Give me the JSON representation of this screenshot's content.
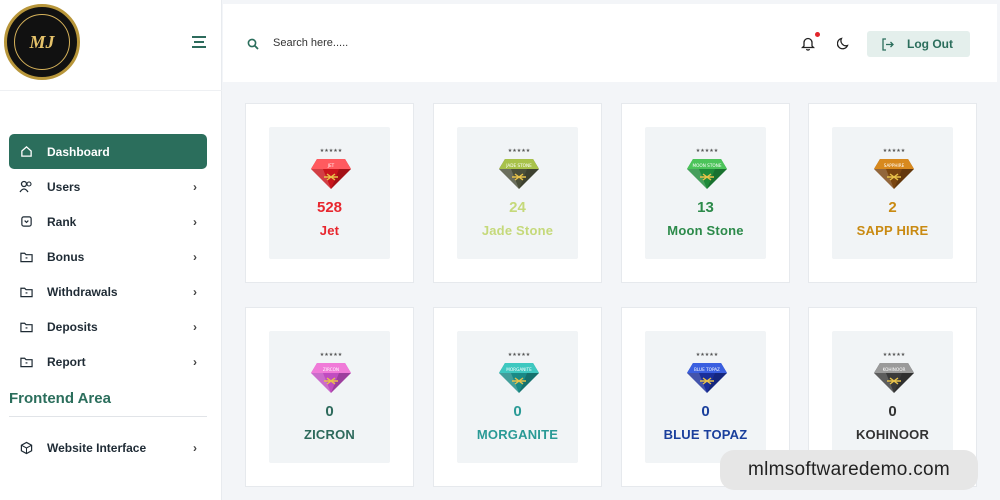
{
  "brand": {
    "logo_text": "MJ"
  },
  "search": {
    "placeholder": "Search here....."
  },
  "topbar": {
    "logout_label": "Log Out"
  },
  "sidebar": {
    "items": [
      {
        "label": "Dashboard",
        "icon": "home-icon",
        "active": true
      },
      {
        "label": "Users",
        "icon": "users-icon"
      },
      {
        "label": "Rank",
        "icon": "rank-icon"
      },
      {
        "label": "Bonus",
        "icon": "folder-icon"
      },
      {
        "label": "Withdrawals",
        "icon": "folder-icon"
      },
      {
        "label": "Deposits",
        "icon": "folder-icon"
      },
      {
        "label": "Report",
        "icon": "folder-icon"
      }
    ],
    "frontend_title": "Frontend Area",
    "frontend_items": [
      {
        "label": "Website Interface",
        "icon": "cube-icon"
      }
    ]
  },
  "cards": [
    {
      "count": "528",
      "name": "Jet",
      "gem_label": "JET",
      "color": "#e8262e",
      "gem_top": "#ff5a5f",
      "gem_bottom": "#c9141c"
    },
    {
      "count": "24",
      "name": "Jade Stone",
      "gem_label": "JADE STONE",
      "color": "#c5d97a",
      "gem_top": "#a8c24a",
      "gem_bottom": "#4b4f3a"
    },
    {
      "count": "13",
      "name": "Moon Stone",
      "gem_label": "MOON STONE",
      "color": "#2c8a4a",
      "gem_top": "#4cc45a",
      "gem_bottom": "#1f8a3a"
    },
    {
      "count": "2",
      "name": "SAPP HIRE",
      "gem_label": "SAPPHIRE",
      "color": "#c98a12",
      "gem_top": "#d8891e",
      "gem_bottom": "#7a4510"
    },
    {
      "count": "0",
      "name": "ZICRON",
      "gem_label": "ZIRCON",
      "color": "#2e6a5c",
      "gem_top": "#f07ad8",
      "gem_bottom": "#c04cc0"
    },
    {
      "count": "0",
      "name": "MORGANITE",
      "gem_label": "MORGANITE",
      "color": "#2a9a96",
      "gem_top": "#3ec8c0",
      "gem_bottom": "#1a8a86"
    },
    {
      "count": "0",
      "name": "BLUE TOPAZ",
      "gem_label": "BLUE TOPAZ",
      "color": "#1a3f9c",
      "gem_top": "#3a5fe0",
      "gem_bottom": "#1a2f9a"
    },
    {
      "count": "0",
      "name": "KOHINOOR",
      "gem_label": "KOHINOOR",
      "color": "#333333",
      "gem_top": "#9a9a9a",
      "gem_bottom": "#3a3a3a"
    }
  ],
  "watermark": "mlmsoftwaredemo.com"
}
